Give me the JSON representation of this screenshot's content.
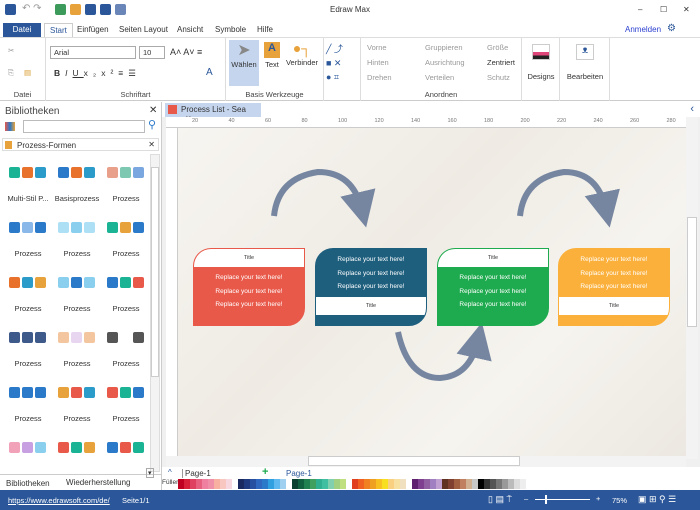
{
  "app": {
    "title": "Edraw Max"
  },
  "window": {
    "minimize": "–",
    "maximize": "☐",
    "close": "✕"
  },
  "tabs": [
    {
      "label": "Datei"
    },
    {
      "label": "Start"
    },
    {
      "label": "Einfügen"
    },
    {
      "label": "Seiten Layout"
    },
    {
      "label": "Ansicht"
    },
    {
      "label": "Symbole"
    },
    {
      "label": "Hilfe"
    }
  ],
  "account": {
    "signin": "Anmelden"
  },
  "ribbon": {
    "groups": {
      "datei": "Datei",
      "schriftart": "Schriftart",
      "basis": "Basis Werkzeuge",
      "anordnen": "Anordnen"
    },
    "font": "Arial",
    "size": "10",
    "tools": {
      "select": "Wählen",
      "text": "Text",
      "connector": "Verbinder"
    },
    "arrange": [
      "Vorne",
      "Hinten",
      "Drehen",
      "Gruppieren",
      "Ausrichtung",
      "Verteilen",
      "Größe",
      "Zentriert",
      "Schutz"
    ],
    "designs": "Designs",
    "edit": "Bearbeiten"
  },
  "library": {
    "title": "Bibliotheken",
    "search_placeholder": "",
    "category": "Prozess-Formen",
    "items": [
      "Multi-Stil P...",
      "Basisprozess",
      "Prozess",
      "Prozess",
      "Prozess",
      "Prozess",
      "Prozess",
      "Prozess",
      "Prozess",
      "Prozess",
      "Prozess",
      "Prozess",
      "Prozess",
      "Prozess",
      "Prozess"
    ],
    "bottom_tabs": [
      "Bibliotheken",
      "Wiederherstellung"
    ]
  },
  "document": {
    "tab": "Process List - Sea",
    "ruler": [
      "20",
      "40",
      "60",
      "80",
      "100",
      "120",
      "140",
      "160",
      "180",
      "200",
      "220",
      "240",
      "260",
      "280"
    ]
  },
  "diagram": {
    "cards": [
      {
        "title": "Title",
        "lines": [
          "Replace your text here!",
          "Replace your text here!",
          "Replace your text here!"
        ],
        "color": "#e8594a",
        "title_pos": "top"
      },
      {
        "title": "Title",
        "lines": [
          "Replace your text here!",
          "Replace your text here!",
          "Replace your text here!"
        ],
        "color": "#1e5f7e",
        "title_pos": "bottom"
      },
      {
        "title": "Title",
        "lines": [
          "Replace your text here!",
          "Replace your text here!",
          "Replace your text here!"
        ],
        "color": "#1eaa4e",
        "title_pos": "top"
      },
      {
        "title": "Title",
        "lines": [
          "Replace your text here!",
          "Replace your text here!",
          "Replace your text here!"
        ],
        "color": "#fbb03b",
        "title_pos": "bottom"
      }
    ],
    "arrow_color": "#7686a0"
  },
  "pages": {
    "current": "Page-1",
    "tab": "Page-1",
    "fill_label": "Füller"
  },
  "status": {
    "url": "https://www.edrawsoft.com/de/",
    "page": "Seite1/1",
    "zoom": "75%"
  }
}
